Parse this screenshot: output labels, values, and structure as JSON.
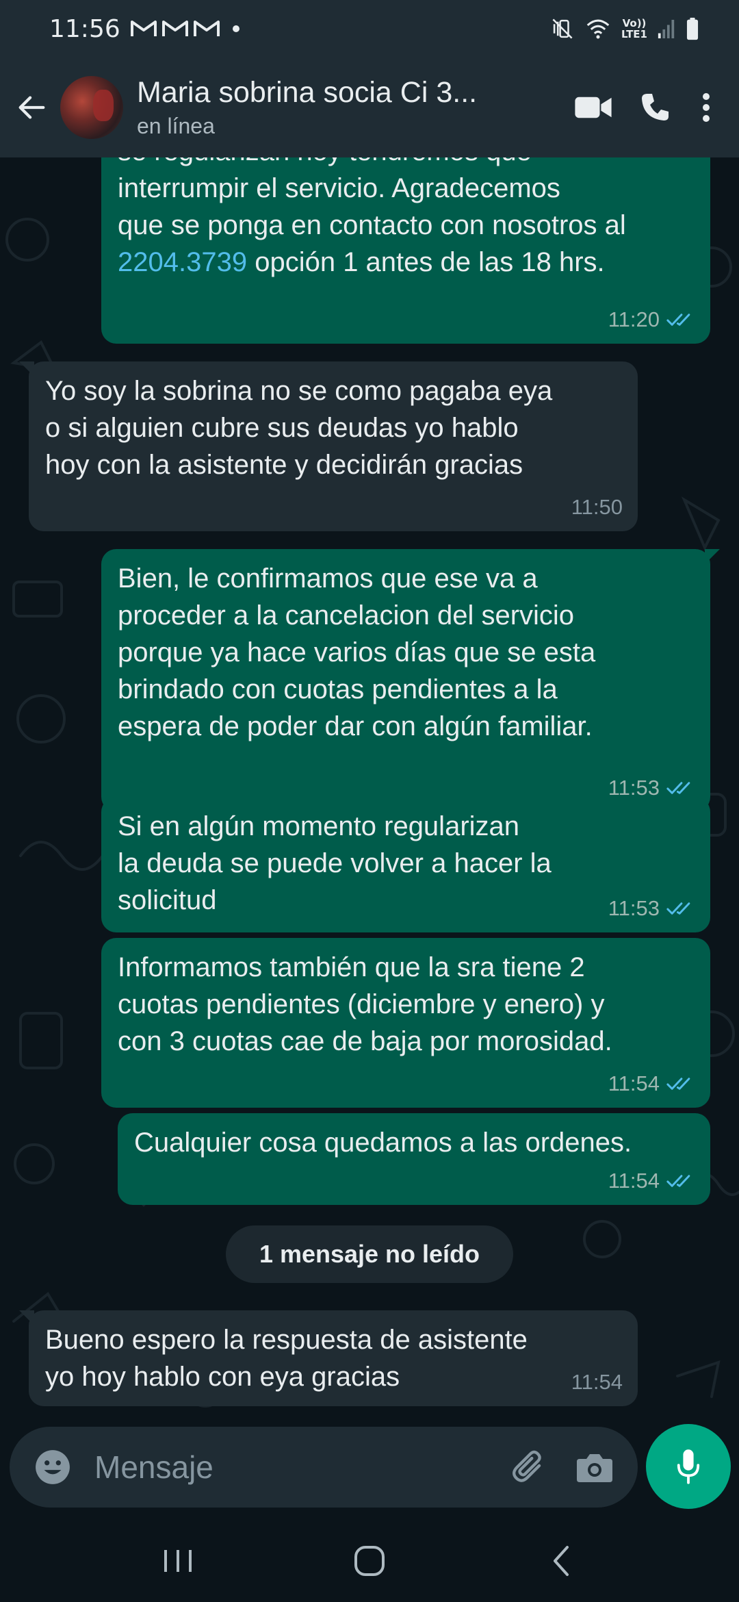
{
  "status_bar": {
    "time": "11:56",
    "notification_icons": [
      "gmail-icon",
      "gmail-icon",
      "gmail-icon"
    ],
    "network_label_top": "Vo))",
    "network_label_bottom": "LTE1"
  },
  "header": {
    "contact_name": "Maria sobrina socia Ci 3...",
    "contact_status": "en línea"
  },
  "colors": {
    "outgoing_bubble": "#005c4b",
    "incoming_bubble": "#202c33",
    "accent": "#00a884",
    "read_ticks": "#53bdeb"
  },
  "messages": [
    {
      "direction": "outgoing",
      "text_before_link": "se regularizan hoy tendremos que\ninterrumpir el servicio. Agradecemos\nque se ponga en contacto con nosotros al\n",
      "link": "2204.3739",
      "text_after_link": " opción 1 antes de las 18 hrs.",
      "time": "11:20",
      "status": "read"
    },
    {
      "direction": "incoming",
      "text": "Yo soy la sobrina no se como pagaba eya\no si alguien cubre sus deudas yo hablo\nhoy con la asistente y decidirán  gracias",
      "time": "11:50"
    },
    {
      "direction": "outgoing",
      "text": "Bien, le confirmamos que ese va a\nproceder a la cancelacion del servicio\nporque ya hace varios días que se esta\nbrindado con cuotas pendientes a la\nespera de poder dar con algún familiar.",
      "time": "11:53",
      "status": "read"
    },
    {
      "direction": "outgoing",
      "text": "Si en algún momento regularizan\nla deuda se puede volver a hacer la\nsolicitud",
      "time": "11:53",
      "status": "read"
    },
    {
      "direction": "outgoing",
      "text": "Informamos también que la sra tiene 2\ncuotas pendientes (diciembre y enero) y\ncon 3 cuotas cae de baja por morosidad.",
      "time": "11:54",
      "status": "read"
    },
    {
      "direction": "outgoing",
      "text": "Cualquier cosa quedamos a las ordenes.",
      "time": "11:54",
      "status": "read"
    },
    {
      "direction": "incoming",
      "text": "Bueno espero la respuesta de asistente\nyo hoy hablo con eya gracias",
      "time": "11:54"
    }
  ],
  "unread_divider": "1 mensaje no leído",
  "composer": {
    "placeholder": "Mensaje",
    "value": ""
  },
  "nav_icons": [
    "recent-apps-icon",
    "home-icon",
    "back-icon"
  ]
}
